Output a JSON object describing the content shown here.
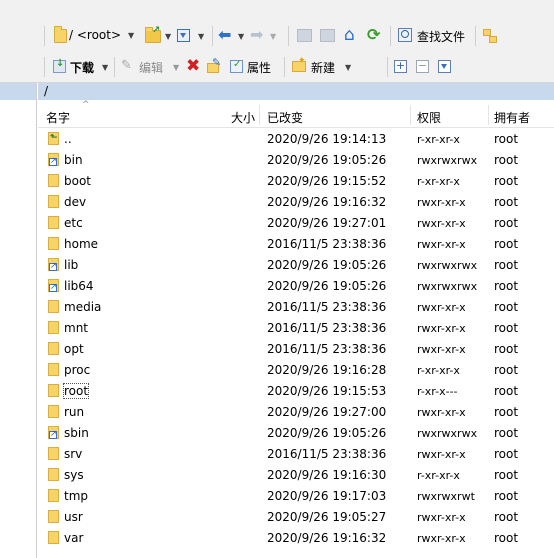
{
  "toolbar1": {
    "path_combo": "/ <root>",
    "find_files_label": "查找文件"
  },
  "toolbar2": {
    "download_label": "下载",
    "edit_label": "编辑",
    "properties_label": "属性",
    "new_label": "新建"
  },
  "path": "/",
  "columns": {
    "name": "名字",
    "size": "大小",
    "modified": "已改变",
    "permissions": "权限",
    "owner": "拥有者"
  },
  "files": [
    {
      "name": "..",
      "type": "parent",
      "modified": "2020/9/26 19:14:13",
      "permissions": "r-xr-xr-x",
      "owner": "root"
    },
    {
      "name": "bin",
      "type": "link",
      "modified": "2020/9/26 19:05:26",
      "permissions": "rwxrwxrwx",
      "owner": "root"
    },
    {
      "name": "boot",
      "type": "folder",
      "modified": "2020/9/26 19:15:52",
      "permissions": "r-xr-xr-x",
      "owner": "root"
    },
    {
      "name": "dev",
      "type": "folder",
      "modified": "2020/9/26 19:16:32",
      "permissions": "rwxr-xr-x",
      "owner": "root"
    },
    {
      "name": "etc",
      "type": "folder",
      "modified": "2020/9/26 19:27:01",
      "permissions": "rwxr-xr-x",
      "owner": "root"
    },
    {
      "name": "home",
      "type": "folder",
      "modified": "2016/11/5 23:38:36",
      "permissions": "rwxr-xr-x",
      "owner": "root"
    },
    {
      "name": "lib",
      "type": "link",
      "modified": "2020/9/26 19:05:26",
      "permissions": "rwxrwxrwx",
      "owner": "root"
    },
    {
      "name": "lib64",
      "type": "link",
      "modified": "2020/9/26 19:05:26",
      "permissions": "rwxrwxrwx",
      "owner": "root"
    },
    {
      "name": "media",
      "type": "folder",
      "modified": "2016/11/5 23:38:36",
      "permissions": "rwxr-xr-x",
      "owner": "root"
    },
    {
      "name": "mnt",
      "type": "folder",
      "modified": "2016/11/5 23:38:36",
      "permissions": "rwxr-xr-x",
      "owner": "root"
    },
    {
      "name": "opt",
      "type": "folder",
      "modified": "2016/11/5 23:38:36",
      "permissions": "rwxr-xr-x",
      "owner": "root"
    },
    {
      "name": "proc",
      "type": "folder",
      "modified": "2020/9/26 19:16:28",
      "permissions": "r-xr-xr-x",
      "owner": "root"
    },
    {
      "name": "root",
      "type": "folder",
      "modified": "2020/9/26 19:15:53",
      "permissions": "r-xr-x---",
      "owner": "root",
      "focused": true
    },
    {
      "name": "run",
      "type": "folder",
      "modified": "2020/9/26 19:27:00",
      "permissions": "rwxr-xr-x",
      "owner": "root"
    },
    {
      "name": "sbin",
      "type": "link",
      "modified": "2020/9/26 19:05:26",
      "permissions": "rwxrwxrwx",
      "owner": "root"
    },
    {
      "name": "srv",
      "type": "folder",
      "modified": "2016/11/5 23:38:36",
      "permissions": "rwxr-xr-x",
      "owner": "root"
    },
    {
      "name": "sys",
      "type": "folder",
      "modified": "2020/9/26 19:16:30",
      "permissions": "r-xr-xr-x",
      "owner": "root"
    },
    {
      "name": "tmp",
      "type": "folder",
      "modified": "2020/9/26 19:17:03",
      "permissions": "rwxrwxrwt",
      "owner": "root"
    },
    {
      "name": "usr",
      "type": "folder",
      "modified": "2020/9/26 19:05:27",
      "permissions": "rwxr-xr-x",
      "owner": "root"
    },
    {
      "name": "var",
      "type": "folder",
      "modified": "2020/9/26 19:16:32",
      "permissions": "rwxr-xr-x",
      "owner": "root"
    }
  ],
  "colors": {
    "path_bar_bg": "#c8d9ed",
    "toolbar_bg": "#f1f1f1",
    "folder_yellow": "#f6d467",
    "delete_red": "#d42020",
    "refresh_green": "#3a9a2a",
    "nav_blue": "#2f73c9"
  }
}
